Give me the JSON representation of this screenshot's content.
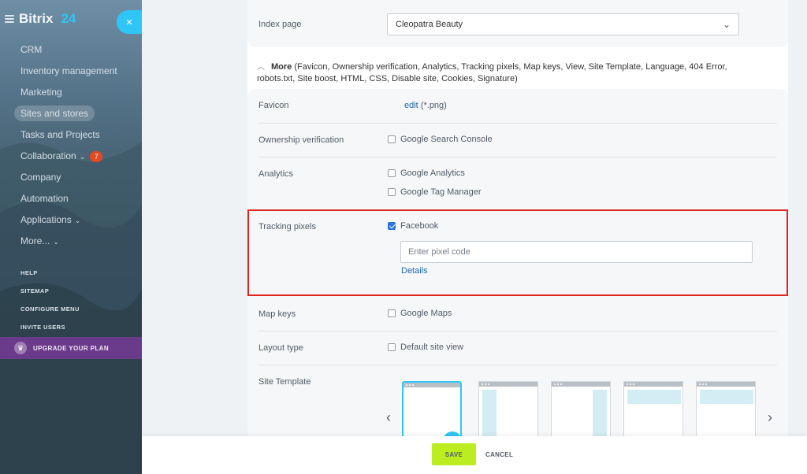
{
  "sidebar": {
    "logo": {
      "brand": "Bitrix",
      "suffix": "24"
    },
    "close_glyph": "×",
    "items": [
      {
        "label": "CRM"
      },
      {
        "label": "Inventory management"
      },
      {
        "label": "Marketing"
      },
      {
        "label": "Sites and stores",
        "active": true
      },
      {
        "label": "Tasks and Projects"
      },
      {
        "label": "Collaboration",
        "badge": "7",
        "caret": "⌄"
      },
      {
        "label": "Company"
      },
      {
        "label": "Automation"
      },
      {
        "label": "Applications",
        "caret": "⌄"
      },
      {
        "label": "More...",
        "caret": "⌄"
      }
    ],
    "small_items": [
      "HELP",
      "SITEMAP",
      "CONFIGURE MENU",
      "INVITE USERS"
    ],
    "upgrade": "UPGRADE YOUR PLAN"
  },
  "settings": {
    "index_page": {
      "label": "Index page",
      "value": "Cleopatra Beauty"
    },
    "more": {
      "title": "More",
      "details": "(Favicon, Ownership verification, Analytics, Tracking pixels, Map keys, View, Site Template, Language, 404 Error, robots.txt, Site boost, HTML, CSS, Disable site, Cookies, Signature)"
    },
    "favicon": {
      "label": "Favicon",
      "link": "edit",
      "note": "(*.png)"
    },
    "ownership": {
      "label": "Ownership verification",
      "option": "Google Search Console"
    },
    "analytics": {
      "label": "Analytics",
      "option1": "Google Analytics",
      "option2": "Google Tag Manager"
    },
    "tracking": {
      "label": "Tracking pixels",
      "option": "Facebook",
      "placeholder": "Enter pixel code",
      "details": "Details"
    },
    "map_keys": {
      "label": "Map keys",
      "option": "Google Maps"
    },
    "layout": {
      "label": "Layout type",
      "option": "Default site view"
    },
    "template": {
      "label": "Site Template"
    }
  },
  "footer": {
    "save": "SAVE",
    "cancel": "CANCEL"
  }
}
